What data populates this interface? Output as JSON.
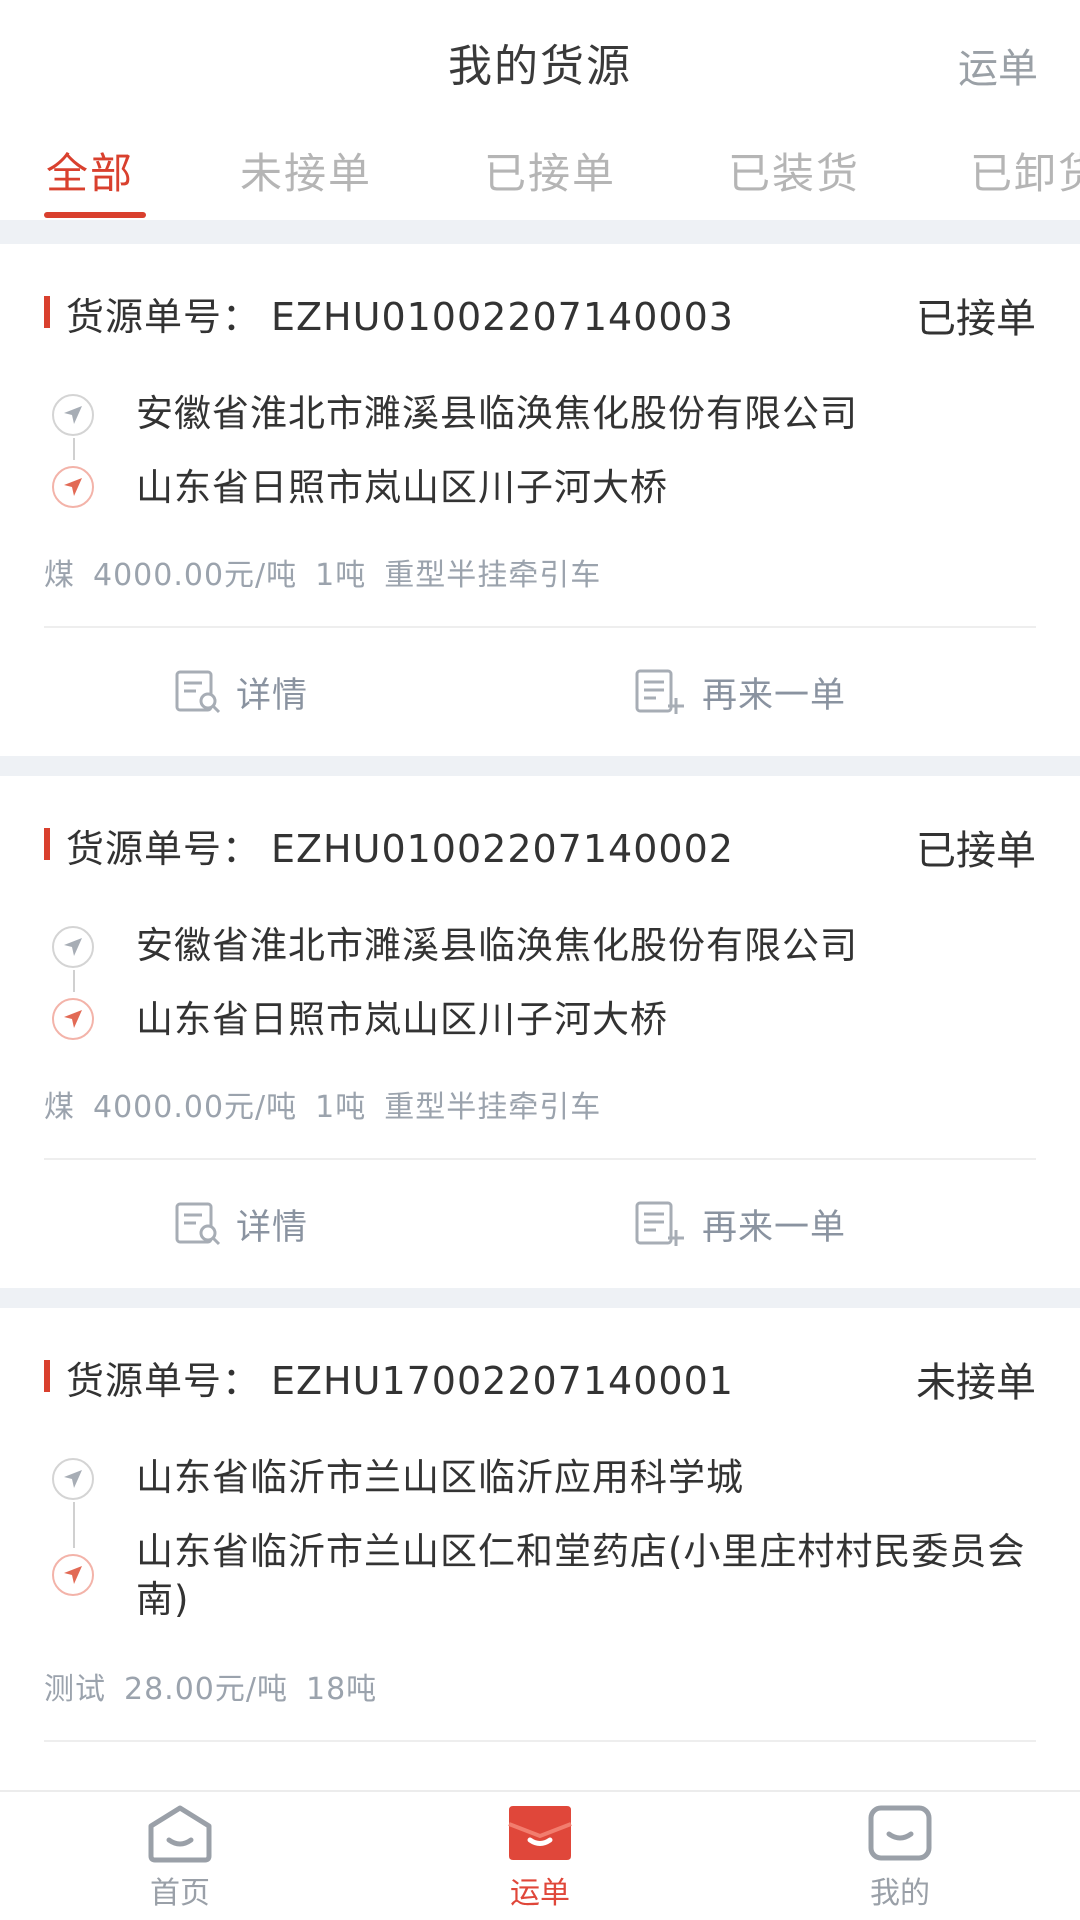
{
  "header": {
    "title": "我的货源",
    "right_link": "运单"
  },
  "tabs": [
    {
      "label": "全部",
      "active": true
    },
    {
      "label": "未接单",
      "active": false
    },
    {
      "label": "已接单",
      "active": false
    },
    {
      "label": "已装货",
      "active": false
    },
    {
      "label": "已卸货",
      "active": false
    }
  ],
  "cards": [
    {
      "order_label": "货源单号：",
      "order_no": "EZHU01002207140003",
      "status": "已接单",
      "from": "安徽省淮北市濉溪县临涣焦化股份有限公司",
      "to": "山东省日照市岚山区川子河大桥",
      "goods": "煤",
      "price": "4000.00元/吨",
      "weight": "1吨",
      "vehicle": "重型半挂牵引车",
      "detail_label": "详情",
      "reorder_label": "再来一单"
    },
    {
      "order_label": "货源单号：",
      "order_no": "EZHU01002207140002",
      "status": "已接单",
      "from": "安徽省淮北市濉溪县临涣焦化股份有限公司",
      "to": "山东省日照市岚山区川子河大桥",
      "goods": "煤",
      "price": "4000.00元/吨",
      "weight": "1吨",
      "vehicle": "重型半挂牵引车",
      "detail_label": "详情",
      "reorder_label": "再来一单"
    },
    {
      "order_label": "货源单号：",
      "order_no": "EZHU17002207140001",
      "status": "未接单",
      "from": "山东省临沂市兰山区临沂应用科学城",
      "to": "山东省临沂市兰山区仁和堂药店(小里庄村村民委员会南)",
      "goods": "测试",
      "price": "28.00元/吨",
      "weight": "18吨",
      "vehicle": ""
    }
  ],
  "bottom_nav": [
    {
      "label": "首页",
      "icon": "home-icon",
      "active": false
    },
    {
      "label": "运单",
      "icon": "waybill-icon",
      "active": true
    },
    {
      "label": "我的",
      "icon": "profile-icon",
      "active": false
    }
  ],
  "colors": {
    "accent": "#d9402e",
    "muted": "#9ba3ad",
    "gap": "#eef1f5"
  }
}
